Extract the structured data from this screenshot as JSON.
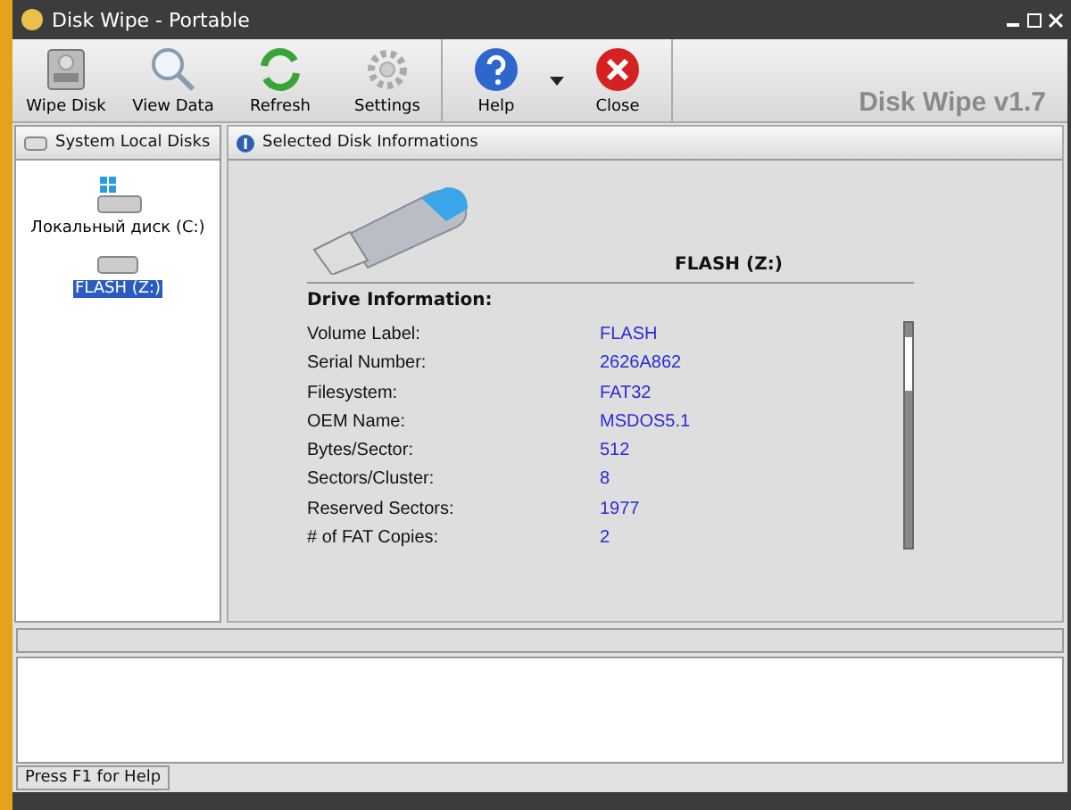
{
  "window": {
    "title": "Disk Wipe  - Portable"
  },
  "toolbar": {
    "groups": [
      [
        {
          "label": "Wipe Disk",
          "kind": "wipe"
        },
        {
          "label": "View Data",
          "kind": "view"
        },
        {
          "label": "Refresh",
          "kind": "refresh"
        },
        {
          "label": "Settings",
          "kind": "settings"
        }
      ],
      [
        {
          "label": "Help",
          "kind": "help"
        },
        {
          "label": "Close",
          "kind": "close"
        }
      ]
    ],
    "brand": "Disk Wipe v1.7"
  },
  "disks_panel": {
    "title": "System Local Disks",
    "items": [
      {
        "label": "Локальный диск (C:)",
        "kind": "system",
        "selected": false
      },
      {
        "label": "FLASH (Z:)",
        "kind": "removable",
        "selected": true
      }
    ]
  },
  "info_panel": {
    "title": "Selected Disk Informations",
    "drive_name": "FLASH  (Z:)",
    "section": "Drive Information:",
    "rows": [
      {
        "label": "Volume Label:",
        "value": "FLASH"
      },
      {
        "label": "Serial Number:",
        "value": "2626A862"
      },
      {
        "label": "Filesystem:",
        "value": "FAT32"
      },
      {
        "label": "OEM Name:",
        "value": "MSDOS5.1"
      },
      {
        "label": "Bytes/Sector:",
        "value": "512"
      },
      {
        "label": "Sectors/Cluster:",
        "value": "8"
      },
      {
        "label": "Reserved Sectors:",
        "value": "1977"
      },
      {
        "label": "# of FAT Copies:",
        "value": "2"
      }
    ]
  },
  "progress": {
    "level": 0
  },
  "status_bar": {
    "text": "Press F1 for Help"
  }
}
